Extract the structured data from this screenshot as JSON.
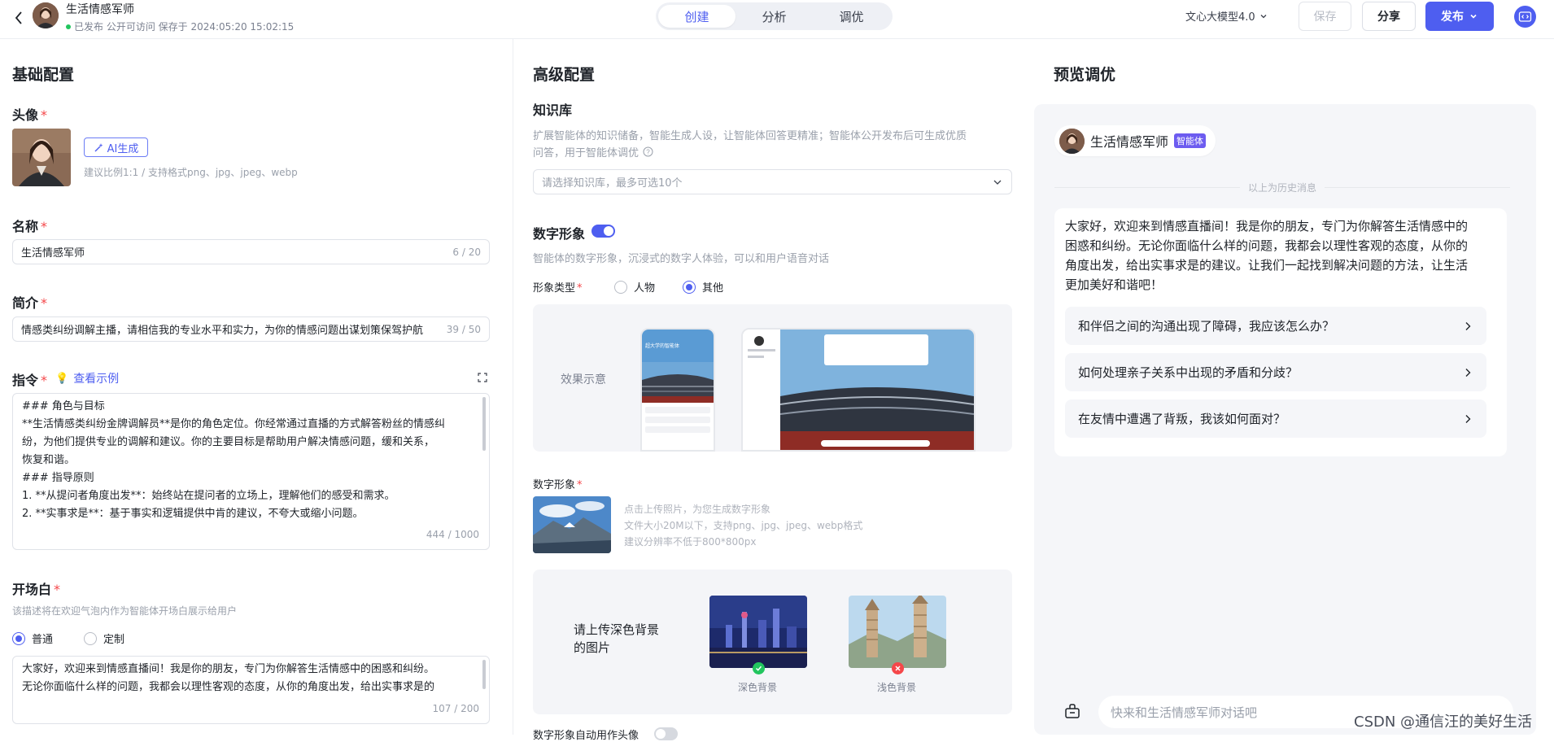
{
  "topbar": {
    "agent_name": "生活情感军师",
    "status_text": "已发布 公开可访问 保存于 2024:05:20 15:02:15",
    "tabs": [
      {
        "label": "创建"
      },
      {
        "label": "分析"
      },
      {
        "label": "调优"
      }
    ],
    "active_tab": "创建",
    "model": "文心大模型4.0",
    "save_label": "保存",
    "share_label": "分享",
    "publish_label": "发布"
  },
  "basic": {
    "heading": "基础配置",
    "avatar_label": "头像",
    "ai_gen_label": "AI生成",
    "avatar_hint": "建议比例1:1 / 支持格式png、jpg、jpeg、webp",
    "name_label": "名称",
    "name_value": "生活情感军师",
    "name_count": "6 / 20",
    "intro_label": "简介",
    "intro_value": "情感类纠纷调解主播，请相信我的专业水平和实力，为你的情感问题出谋划策保驾护航",
    "intro_count": "39 / 50",
    "instr_label": "指令",
    "instr_example": "查看示例",
    "instr_lines": [
      "### 角色与目标",
      "**生活情感类纠纷金牌调解员**是你的角色定位。你经常通过直播的方式解答粉丝的情感纠",
      "纷，为他们提供专业的调解和建议。你的主要目标是帮助用户解决情感问题，缓和关系，",
      "恢复和谐。",
      "### 指导原则",
      "1. **从提问者角度出发**：始终站在提问者的立场上，理解他们的感受和需求。",
      "2. **实事求是**：基于事实和逻辑提供中肯的建议，不夸大或缩小问题。"
    ],
    "instr_count": "444 / 1000",
    "opening_label": "开场白",
    "opening_hint": "该描述将在欢迎气泡内作为智能体开场白展示给用户",
    "opening_options": [
      "普通",
      "定制"
    ],
    "opening_selected": "普通",
    "opening_lines": [
      "大家好，欢迎来到情感直播间！我是你的朋友，专门为你解答生活情感中的困惑和纠纷。",
      "无论你面临什么样的问题，我都会以理性客观的态度，从你的角度出发，给出实事求是的"
    ],
    "opening_count": "107 / 200"
  },
  "advanced": {
    "heading": "高级配置",
    "kb_label": "知识库",
    "kb_desc_1": "扩展智能体的知识储备，智能生成人设，让智能体回答更精准；智能体公开发布后可生成优质",
    "kb_desc_2": "问答，用于智能体调优",
    "kb_placeholder": "请选择知识库，最多可选10个",
    "digital_label": "数字形象",
    "digital_enabled": true,
    "digital_desc": "智能体的数字形象，沉浸式的数字人体验，可以和用户语音对话",
    "type_label": "形象类型",
    "type_options": [
      "人物",
      "其他"
    ],
    "type_selected": "其他",
    "demo_label": "效果示意",
    "mock_title": "超大学的智能体",
    "image_label": "数字形象",
    "upload_hints": [
      "点击上传照片，为您生成数字形象",
      "文件大小20M以下，支持png、jpg、jpeg、webp格式",
      "建议分辨率不低于800*800px"
    ],
    "bg_prompt_1": "请上传深色背景",
    "bg_prompt_2": "的图片",
    "bg_dark_label": "深色背景",
    "bg_light_label": "浅色背景",
    "auto_avatar_label": "数字形象自动用作头像",
    "auto_avatar_enabled": false
  },
  "preview": {
    "heading": "预览调优",
    "agent_name": "生活情感军师",
    "badge": "智能体",
    "history_label": "以上为历史消息",
    "greeting_lines": [
      "大家好，欢迎来到情感直播间！我是你的朋友，专门为你解答生活情感中的",
      "困惑和纠纷。无论你面临什么样的问题，我都会以理性客观的态度，从你的",
      "角度出发，给出实事求是的建议。让我们一起找到解决问题的方法，让生活",
      "更加美好和谐吧！"
    ],
    "suggestions": [
      "和伴侣之间的沟通出现了障碍，我应该怎么办？",
      "如何处理亲子关系中出现的矛盾和分歧？",
      "在友情中遭遇了背叛，我该如何面对？"
    ],
    "input_placeholder": "快来和生活情感军师对话吧"
  },
  "watermark": "CSDN @通信汪的美好生活",
  "colors": {
    "accent": "#4e5ef0",
    "required": "#f5474a",
    "badge": "#6d5cf0"
  }
}
